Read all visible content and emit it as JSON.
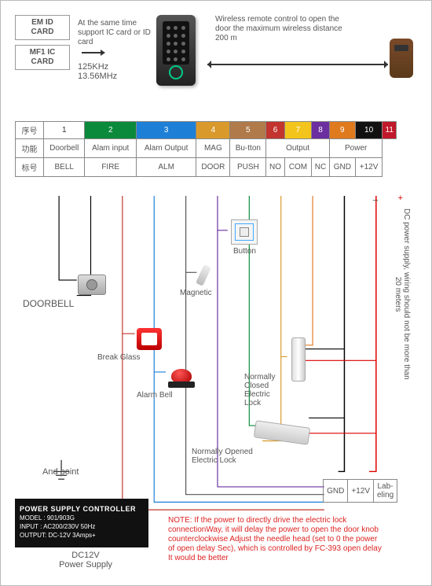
{
  "cards": {
    "em": "EM ID\nCARD",
    "mf": "MF1 IC\nCARD"
  },
  "card_desc": "At the same time support IC card or ID card",
  "freq1": "125KHz",
  "freq2": "13.56MHz",
  "wireless": "Wireless remote control to open the door the maximum wireless distance 200 m",
  "table": {
    "row_labels": [
      "序号",
      "功能",
      "标号"
    ],
    "nums": [
      "1",
      "2",
      "3",
      "4",
      "5",
      "6",
      "7",
      "8",
      "9",
      "10",
      "11"
    ],
    "colors": [
      "#ffffff",
      "#0a8a3a",
      "#1e7fd6",
      "#d99a2b",
      "#b07a4a",
      "#c2342d",
      "#f3c51c",
      "#6b2fa0",
      "#e07a1f",
      "#111111",
      "#c0182b"
    ],
    "func": [
      "Doorbell",
      "Alam input",
      "Alam Output",
      "MAG",
      "Bu-tton",
      "Output",
      "Power"
    ],
    "func_span": [
      1,
      1,
      1,
      1,
      1,
      3,
      2
    ],
    "label": [
      "BELL",
      "FIRE",
      "ALM",
      "DOOR",
      "PUSH",
      "NO",
      "COM",
      "NC",
      "GND",
      "+12V"
    ],
    "label_lead_span": 1
  },
  "components": {
    "doorbell": "DOORBELL",
    "breakglass": "Break Glass",
    "alarm": "Alarm Bell",
    "magnetic": "Magnetic",
    "button": "Button",
    "nclock": "Normally\nClosed\nElectric\nLock",
    "nolock": "Normally Opened\nElectric Lock",
    "andpoint": "And point"
  },
  "labtable": {
    "gnd": "GND",
    "v12": "+12V",
    "lab": "Lab-eling"
  },
  "vnote": "DC power supply, wiring should not be more than 20 meters",
  "psu": {
    "title": "POWER SUPPLY CONTROLLER",
    "model": "MODEL : 901/903G",
    "input": "INPUT : AC200/230V  50Hz",
    "output": "OUTPUT: DC-12V  3Amps+",
    "label": "DC12V\nPower Supply"
  },
  "note": "NOTE: If the power to directly drive the electric lock connectionWay, it will delay the power to open the door knob counterclockwise Adjust the needle head (set to 0 the power of open delay Sec), which is controlled by FC-393 open delay It would be better"
}
